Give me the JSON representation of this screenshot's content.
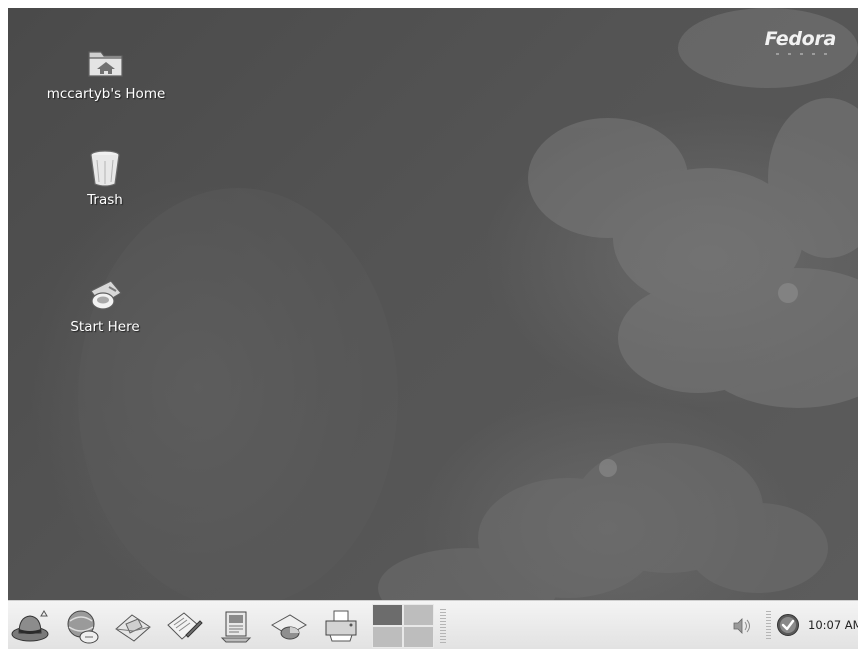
{
  "branding": {
    "logo_text": "Fedora"
  },
  "desktop": {
    "icons": [
      {
        "label": "mccartyb's Home",
        "icon": "home-folder-icon"
      },
      {
        "label": "Trash",
        "icon": "trash-icon"
      },
      {
        "label": "Start Here",
        "icon": "start-here-icon"
      }
    ]
  },
  "panel": {
    "launchers": [
      {
        "icon": "main-menu-redhat-icon"
      },
      {
        "icon": "web-browser-icon"
      },
      {
        "icon": "email-client-icon"
      },
      {
        "icon": "word-processor-icon"
      },
      {
        "icon": "presentation-icon"
      },
      {
        "icon": "spreadsheet-icon"
      },
      {
        "icon": "print-manager-icon"
      }
    ],
    "workspace_switcher": {
      "workspaces": 4,
      "active": 1
    },
    "tray": {
      "volume_icon": "volume-icon",
      "update_icon": "update-status-icon",
      "clock": "10:07 AM"
    }
  },
  "colors": {
    "desktop_background": "#4f4f4f",
    "panel_background": "#e8e8e8",
    "label_text": "#ffffff"
  }
}
